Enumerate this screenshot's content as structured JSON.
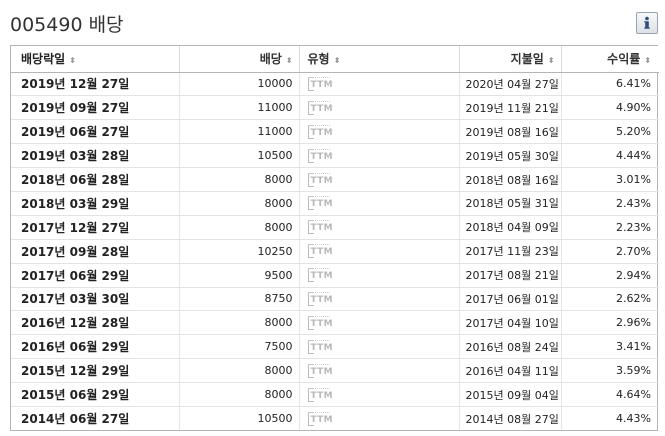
{
  "header": {
    "title": "005490 배당",
    "info_icon": "info-icon"
  },
  "table": {
    "columns": [
      {
        "label": "배당락일",
        "sort_icon": "sort-icon"
      },
      {
        "label": "배당",
        "sort_icon": "sort-icon"
      },
      {
        "label": "유형",
        "sort_icon": "sort-icon"
      },
      {
        "label": "지불일",
        "sort_icon": "sort-icon"
      },
      {
        "label": "수익률",
        "sort_icon": "sort-icon"
      }
    ],
    "sort_glyph": "⬍",
    "type_badge_text": "TTM",
    "rows": [
      {
        "ex_date": "2019년 12월 27일",
        "amount": "10000",
        "type": "TTM",
        "pay_date": "2020년 04월 27일",
        "yield": "6.41%"
      },
      {
        "ex_date": "2019년 09월 27일",
        "amount": "11000",
        "type": "TTM",
        "pay_date": "2019년 11월 21일",
        "yield": "4.90%"
      },
      {
        "ex_date": "2019년 06월 27일",
        "amount": "11000",
        "type": "TTM",
        "pay_date": "2019년 08월 16일",
        "yield": "5.20%"
      },
      {
        "ex_date": "2019년 03월 28일",
        "amount": "10500",
        "type": "TTM",
        "pay_date": "2019년 05월 30일",
        "yield": "4.44%"
      },
      {
        "ex_date": "2018년 06월 28일",
        "amount": "8000",
        "type": "TTM",
        "pay_date": "2018년 08월 16일",
        "yield": "3.01%"
      },
      {
        "ex_date": "2018년 03월 29일",
        "amount": "8000",
        "type": "TTM",
        "pay_date": "2018년 05월 31일",
        "yield": "2.43%"
      },
      {
        "ex_date": "2017년 12월 27일",
        "amount": "8000",
        "type": "TTM",
        "pay_date": "2018년 04월 09일",
        "yield": "2.23%"
      },
      {
        "ex_date": "2017년 09월 28일",
        "amount": "10250",
        "type": "TTM",
        "pay_date": "2017년 11월 23일",
        "yield": "2.70%"
      },
      {
        "ex_date": "2017년 06월 29일",
        "amount": "9500",
        "type": "TTM",
        "pay_date": "2017년 08월 21일",
        "yield": "2.94%"
      },
      {
        "ex_date": "2017년 03월 30일",
        "amount": "8750",
        "type": "TTM",
        "pay_date": "2017년 06월 01일",
        "yield": "2.62%"
      },
      {
        "ex_date": "2016년 12월 28일",
        "amount": "8000",
        "type": "TTM",
        "pay_date": "2017년 04월 10일",
        "yield": "2.96%"
      },
      {
        "ex_date": "2016년 06월 29일",
        "amount": "7500",
        "type": "TTM",
        "pay_date": "2016년 08월 24일",
        "yield": "3.41%"
      },
      {
        "ex_date": "2015년 12월 29일",
        "amount": "8000",
        "type": "TTM",
        "pay_date": "2016년 04월 11일",
        "yield": "3.59%"
      },
      {
        "ex_date": "2015년 06월 29일",
        "amount": "8000",
        "type": "TTM",
        "pay_date": "2015년 09월 04일",
        "yield": "4.64%"
      },
      {
        "ex_date": "2014년 06월 27일",
        "amount": "10500",
        "type": "TTM",
        "pay_date": "2014년 08월 27일",
        "yield": "4.43%"
      }
    ]
  }
}
